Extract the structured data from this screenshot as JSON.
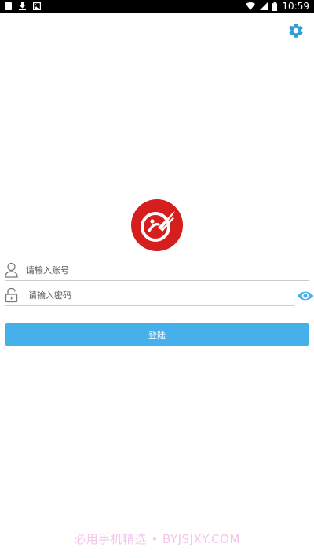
{
  "status_bar": {
    "time": "10:59",
    "left_icons": [
      "notification-square-icon",
      "download-icon",
      "image-icon"
    ],
    "right_icons": [
      "wifi-icon",
      "signal-icon",
      "battery-icon"
    ]
  },
  "header": {
    "settings_icon": "gear-icon"
  },
  "login": {
    "account_placeholder": "请输入账号",
    "account_value": "",
    "password_placeholder": "请输入密码",
    "password_value": "",
    "submit_label": "登陆"
  },
  "icons": {
    "account": "user-icon",
    "password": "lock-icon",
    "toggle_password": "eye-icon"
  },
  "colors": {
    "accent": "#45b0ea",
    "logo_red": "#d51f1f",
    "divider": "#cccccc",
    "watermark": "#f4c6ea"
  },
  "watermark": "必用手机精选 • BYJSJXY.COM"
}
